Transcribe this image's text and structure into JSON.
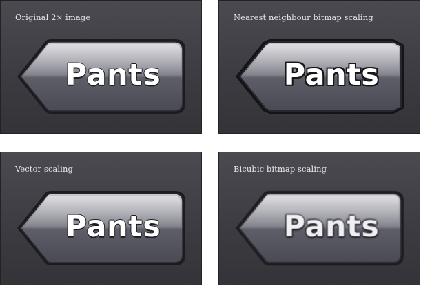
{
  "panels": [
    {
      "caption": "Original 2× image",
      "button_label": "Pants"
    },
    {
      "caption": "Nearest neighbour bitmap scaling",
      "button_label": "Pants"
    },
    {
      "caption": "Vector scaling",
      "button_label": "Pants"
    },
    {
      "caption": "Bicubic bitmap scaling",
      "button_label": "Pants"
    }
  ],
  "colors": {
    "panel_background": "#3f3f45",
    "panel_border": "#232326",
    "button_outline": "#1a1a1e",
    "button_highlight": "#dcdce2",
    "label_color": "#ffffff"
  },
  "icons": {
    "button_shape": "left-pointing-back-arrow"
  }
}
